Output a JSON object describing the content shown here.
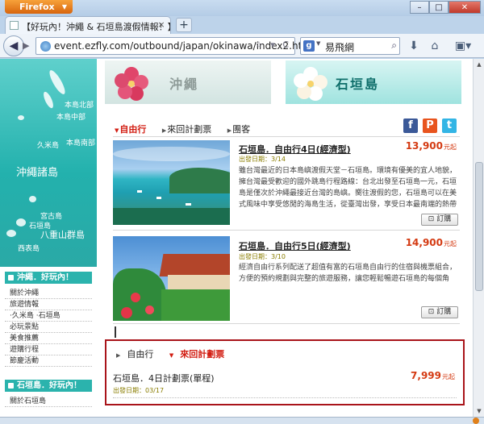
{
  "browser": {
    "firefox_button": "Firefox",
    "tab_title": "【好玩內！沖繩 & 石垣島渡假情報！】",
    "url": "event.ezfly.com/outbound/japan/okinawa/index2.html",
    "search_engine_icon": "google-icon",
    "search_text": "易飛網"
  },
  "sidebar": {
    "map_labels": {
      "title": "沖繩諸島",
      "north": "本島北部",
      "middle": "本島中部",
      "south": "本島南部",
      "kume": "久米島",
      "miyako": "宮古島",
      "ishigaki": "石垣島",
      "yaeyama": "八重山群島",
      "iriomote": "西表島"
    },
    "section1": {
      "heading": "沖繩．好玩內！",
      "items": [
        "關於沖繩",
        "旅遊情報",
        "‧久米島 ‧石垣島",
        "必玩景點",
        "美食推薦",
        "遊購行程",
        "節慶活動"
      ]
    },
    "section2": {
      "heading": "石垣島．好玩內！",
      "items": [
        "關於石垣島"
      ]
    }
  },
  "banners": {
    "left": "沖繩",
    "right": "石垣島"
  },
  "tabs_top": {
    "free_travel": "自由行",
    "plan": "來回計劃票",
    "group": "團客"
  },
  "products": [
    {
      "title": "石垣島．自由行4日(經濟型)",
      "date_label": "出發日期：3/14",
      "desc": "雖台灣最近的日本島嶼渡假天堂－石垣島。環境有優美的宜人地貌，擁台灣最受歡迎的國外跳島行程路線：台北出發至石垣島一元，石垣島是僅次於沖繩最接近台灣的島嶼。嚮往渡假的您，石垣島可以在美式風味中享受悠閒的海島生活，從臺灣出發，享受日本最南端的熱帶風情，另外還有眾多美麗的海灘、潛水勝地與自然景觀，是適合全家大小一同前往的渡假勝地……",
      "price": "13,900",
      "unit": "元起",
      "book_label": "訂購"
    },
    {
      "title": "石垣島．自由行5日(經濟型)",
      "date_label": "出發日期：3/10",
      "desc": "經濟自由行系列配送了超值有富的石垣島自由行的住宿與機票組合，方便的預約規劃與完整的旅遊服務，讓您輕鬆暢遊石垣島的每個角落。",
      "price": "14,900",
      "unit": "元起",
      "book_label": "訂購"
    }
  ],
  "tabs_bottom": {
    "free_travel": "自由行",
    "plan": "來回計劃票"
  },
  "plan": {
    "title": "石垣島．4日計劃票(單程)",
    "date_label": "出發日期：03/17",
    "price": "7,999",
    "unit": "元起"
  },
  "colors": {
    "accent_red": "#d21c11",
    "price_orange": "#d43a12",
    "teal": "#2bb3ad",
    "highlight_border": "#a9141a"
  }
}
